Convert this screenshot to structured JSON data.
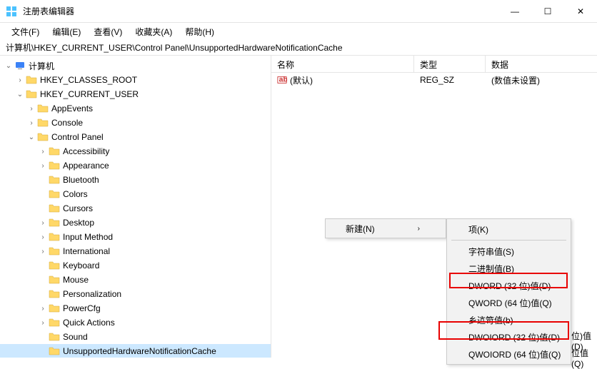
{
  "window": {
    "title": "注册表编辑器"
  },
  "win_controls": {
    "min": "—",
    "max": "☐",
    "close": "✕"
  },
  "menubar": {
    "file": "文件(F)",
    "edit": "编辑(E)",
    "view": "查看(V)",
    "favorites": "收藏夹(A)",
    "help": "帮助(H)"
  },
  "address": "计算机\\HKEY_CURRENT_USER\\Control Panel\\UnsupportedHardwareNotificationCache",
  "tree": {
    "root": "计算机",
    "hkcr": "HKEY_CLASSES_ROOT",
    "hkcu": "HKEY_CURRENT_USER",
    "appevents": "AppEvents",
    "console": "Console",
    "control_panel": "Control Panel",
    "accessibility": "Accessibility",
    "appearance": "Appearance",
    "bluetooth": "Bluetooth",
    "colors": "Colors",
    "cursors": "Cursors",
    "desktop": "Desktop",
    "input_method": "Input Method",
    "international": "International",
    "keyboard": "Keyboard",
    "mouse": "Mouse",
    "personalization": "Personalization",
    "powercfg": "PowerCfg",
    "quick_actions": "Quick Actions",
    "sound": "Sound",
    "unsupported": "UnsupportedHardwareNotificationCache"
  },
  "list": {
    "headers": {
      "name": "名称",
      "type": "类型",
      "data": "数据"
    },
    "rows": [
      {
        "name": "(默认)",
        "type": "REG_SZ",
        "data": "(数值未设置)"
      }
    ]
  },
  "context": {
    "new_label": "新建(N)",
    "items": {
      "key": "项(K)",
      "string": "字符串值(S)",
      "binary": "二进制值(B)",
      "dword": "DWORD (32 位)值(D)",
      "qword": "QWORD (64 位)值(Q)",
      "multi": "乡迒笴值(b)",
      "dword2": "DWOIORD (32 位)值(D)",
      "dword2_tail": "位)值(D)",
      "qword2": "QWOIORD (64 位)值(Q)",
      "qword2_tail": "位值(Q)"
    }
  }
}
